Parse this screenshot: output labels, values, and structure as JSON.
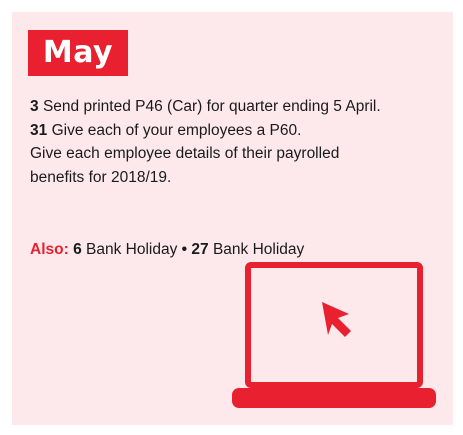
{
  "month": "May",
  "entries": [
    {
      "day": "3",
      "text": "Send printed P46 (Car) for quarter ending 5 April."
    },
    {
      "day": "31",
      "text": "Give each of your employees a P60."
    },
    {
      "day": "",
      "text": "Give each employee details of their payrolled benefits for 2018/19."
    }
  ],
  "also": {
    "label": "Also:",
    "holidays": [
      {
        "day": "6",
        "text": "Bank Holiday"
      },
      {
        "day": "27",
        "text": "Bank Holiday"
      }
    ],
    "separator": "•"
  },
  "illustration": {
    "icon": "laptop-with-cursor-icon",
    "accent_color": "#e8202f"
  },
  "colors": {
    "panel_background": "#fde9ec",
    "accent": "#e8202f",
    "text": "#1a1a1a"
  }
}
